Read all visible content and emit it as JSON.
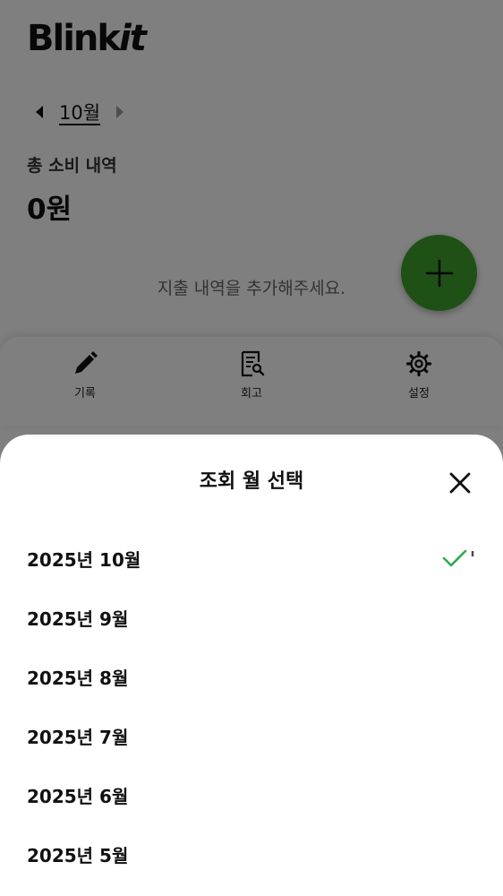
{
  "app": {
    "logo_main": "Blink",
    "logo_italic": "it"
  },
  "month_nav": {
    "current": "10월",
    "prev_icon": "caret-left-icon",
    "next_icon": "caret-right-icon"
  },
  "summary": {
    "label": "총 소비 내역",
    "amount": "0원"
  },
  "empty_message": "지출 내역을 추가해주세요.",
  "fab": {
    "icon": "plus-icon",
    "color": "#3fa12b"
  },
  "bottom_nav": {
    "items": [
      {
        "label": "기록",
        "icon": "pencil-icon"
      },
      {
        "label": "회고",
        "icon": "document-search-icon"
      },
      {
        "label": "설정",
        "icon": "gear-icon"
      }
    ]
  },
  "sheet": {
    "title": "조회 월 선택",
    "close_icon": "close-icon",
    "selected_index": 0,
    "check_color": "#2fa84f",
    "options": [
      {
        "label": "2025년 10월"
      },
      {
        "label": "2025년 9월"
      },
      {
        "label": "2025년 8월"
      },
      {
        "label": "2025년 7월"
      },
      {
        "label": "2025년 6월"
      },
      {
        "label": "2025년 5월"
      }
    ]
  }
}
